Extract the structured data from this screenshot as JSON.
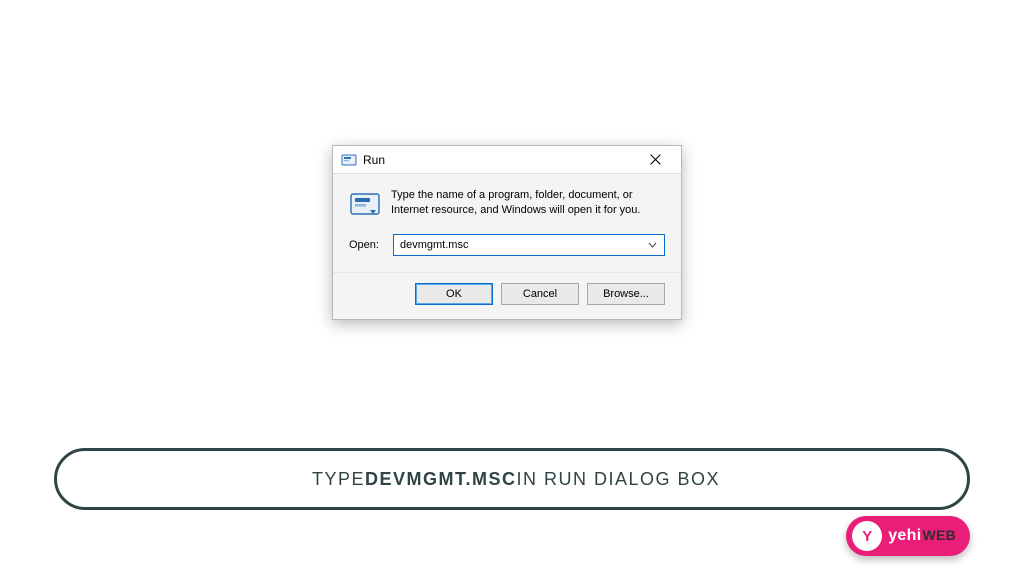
{
  "dialog": {
    "title": "Run",
    "instruction": "Type the name of a program, folder, document, or Internet resource, and Windows will open it for you.",
    "open_label": "Open:",
    "open_value": "devmgmt.msc",
    "buttons": {
      "ok": "OK",
      "cancel": "Cancel",
      "browse": "Browse..."
    },
    "icons": {
      "title_icon": "run-app-icon",
      "body_icon": "run-app-icon",
      "close": "close-icon",
      "chevron": "chevron-down-icon"
    }
  },
  "caption": {
    "pre": "TYPE ",
    "bold": "DEVMGMT.MSC",
    "post": " IN RUN DIALOG BOX"
  },
  "watermark": {
    "glyph": "Y",
    "brand_a": "yehi",
    "brand_b": "WEB"
  },
  "colors": {
    "bg_dark": "#2f4444",
    "accent": "#0a6cce",
    "brand_pink": "#ea1e79"
  }
}
